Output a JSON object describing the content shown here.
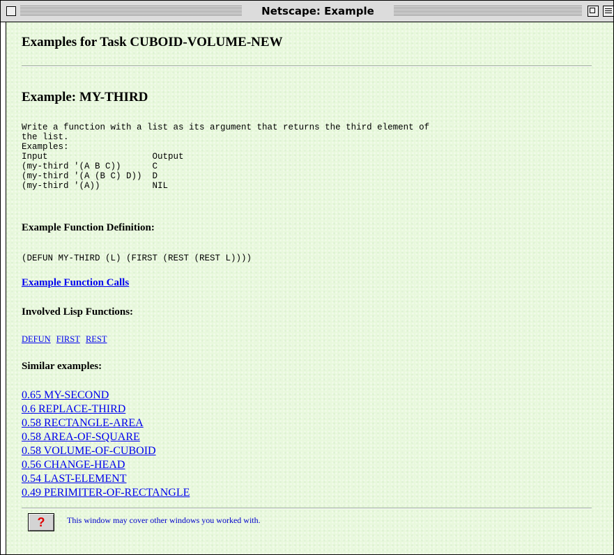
{
  "window": {
    "title": "Netscape: Example"
  },
  "page": {
    "heading": "Examples for Task CUBOID-VOLUME-NEW",
    "example_heading": "Example: MY-THIRD",
    "description": "Write a function with a list as its argument that returns the third element of\nthe list.\nExamples:\nInput                    Output\n(my-third '(A B C))      C\n(my-third '(A (B C) D))  D\n(my-third '(A))          NIL",
    "definition_heading": "Example Function Definition:",
    "definition_code": "(DEFUN MY-THIRD (L) (FIRST (REST (REST L))))",
    "calls_link": "Example Function Calls",
    "lisp_functions_heading": "Involved Lisp Functions:",
    "lisp_functions": [
      "DEFUN",
      "FIRST",
      "REST"
    ],
    "similar_heading": "Similar examples:",
    "similar_examples": [
      "0.65 MY-SECOND",
      "0.6 REPLACE-THIRD",
      "0.58 RECTANGLE-AREA",
      "0.58 AREA-OF-SQUARE",
      "0.58 VOLUME-OF-CUBOID",
      "0.56 CHANGE-HEAD",
      "0.54 LAST-ELEMENT",
      "0.49 PERIMITER-OF-RECTANGLE"
    ],
    "help_button_label": "?",
    "help_text": "This window may cover other windows you worked with."
  },
  "colors": {
    "background": "#e8f8dc",
    "link": "#0000ee",
    "help_text": "#0000cc",
    "help_icon": "#e00000"
  }
}
